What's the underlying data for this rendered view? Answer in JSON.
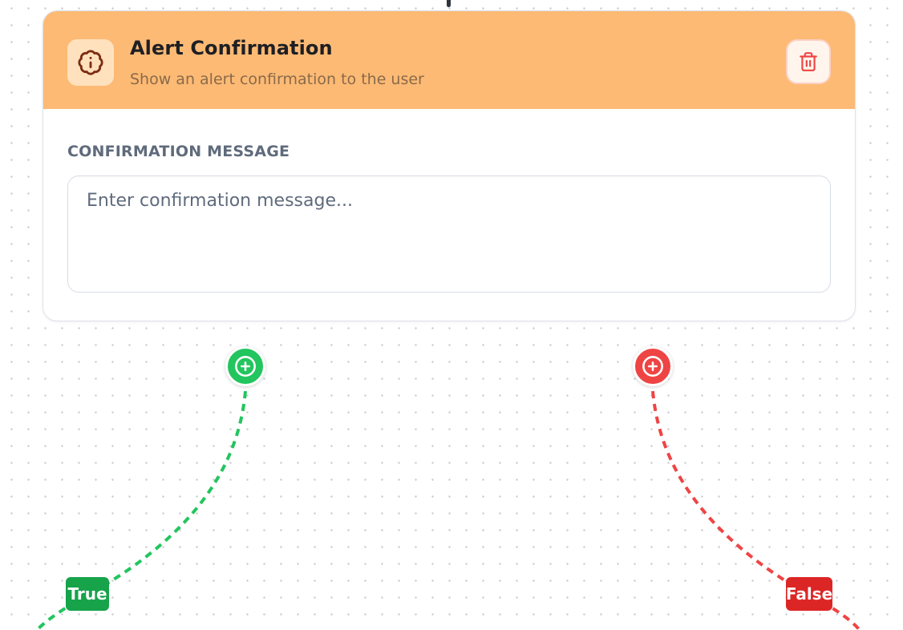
{
  "node": {
    "title": "Alert Confirmation",
    "subtitle": "Show an alert confirmation to the user",
    "header_icon": "badge-info-icon",
    "delete_icon": "trash-icon",
    "field_label": "CONFIRMATION MESSAGE",
    "message_value": "",
    "message_placeholder": "Enter confirmation message..."
  },
  "branches": {
    "true_label": "True",
    "false_label": "False",
    "add_icon": "plus-circle-icon"
  },
  "colors": {
    "header": "#fdba74",
    "true": "#22c55e",
    "true_label": "#16a34a",
    "false": "#ef4444",
    "false_label": "#dc2626",
    "delete_icon": "#ef4444"
  }
}
